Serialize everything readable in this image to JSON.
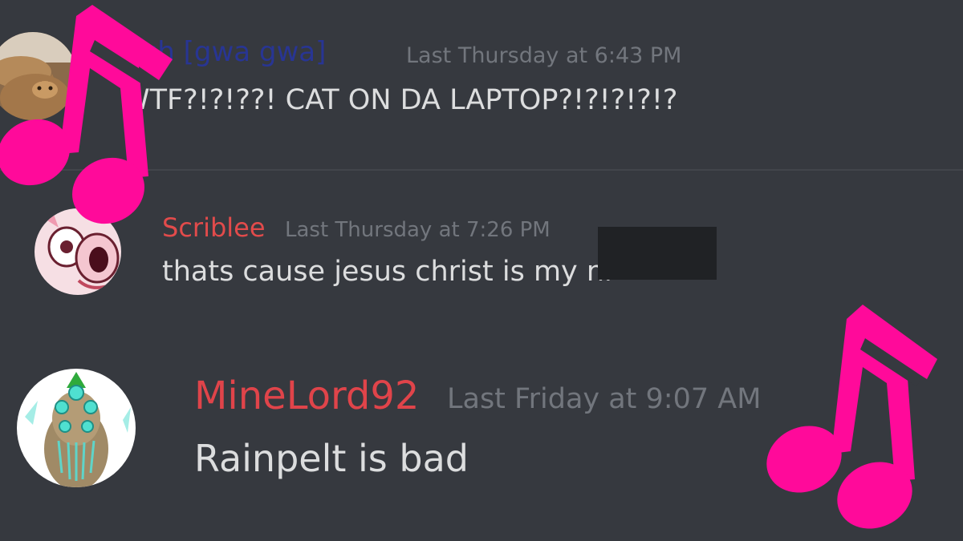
{
  "messages": [
    {
      "username": "Fish [gwa gwa]",
      "timestamp": "Last Thursday at 6:43 PM",
      "text": "WTF?!?!??! CAT ON DA LAPTOP?!?!?!?!?",
      "username_color": "#283593"
    },
    {
      "username": "Scriblee",
      "timestamp": "Last Thursday at 7:26 PM",
      "text": "thats cause jesus christ is my ni",
      "username_color": "#e24b4b"
    },
    {
      "username": "MineLord92",
      "timestamp": "Last Friday at 9:07 AM",
      "text": "Rainpelt is bad",
      "username_color": "#e0444a"
    }
  ],
  "icons": [
    "avatar-cat",
    "avatar-pink-character",
    "avatar-crystal-character",
    "music-note-icon",
    "music-note-icon"
  ],
  "colors": {
    "background": "#36393f",
    "text": "#dcddde",
    "timestamp": "#72767d",
    "music_note": "#ff0a9a",
    "redaction": "#202225"
  }
}
